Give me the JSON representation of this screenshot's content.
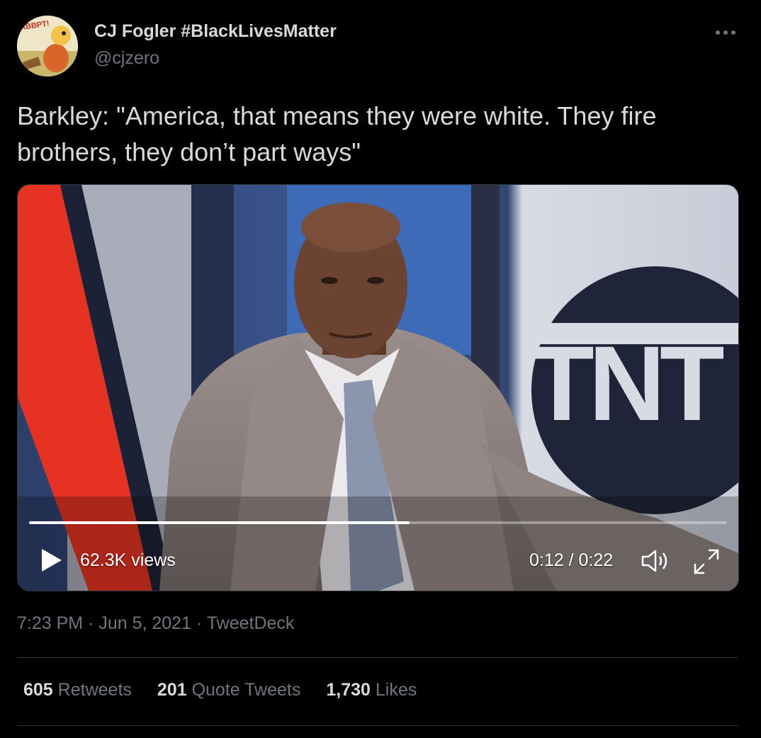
{
  "author": {
    "display_name": "CJ Fogler #BlackLivesMatter",
    "handle": "@cjzero",
    "avatar_text": "ABBPT!"
  },
  "more_icon": "more-horizontal-icon",
  "tweet": {
    "text": "Barkley: \"America, that means they were white. They fire brothers, they don’t part ways\""
  },
  "video": {
    "views": "62.3K views",
    "time": "0:12 / 0:22",
    "progress": 0.545,
    "logo_text": "TNT",
    "icons": [
      "play-icon",
      "volume-icon",
      "fullscreen-icon"
    ]
  },
  "meta": {
    "line": "7:23 PM · Jun 5, 2021 · TweetDeck"
  },
  "stats": [
    {
      "num": "605",
      "label": "Retweets"
    },
    {
      "num": "201",
      "label": "Quote Tweets"
    },
    {
      "num": "1,730",
      "label": "Likes"
    }
  ],
  "colors": {
    "background": "#000000",
    "text": "#d9d9d9",
    "secondary": "#6e767d",
    "divider": "#2f3336"
  }
}
